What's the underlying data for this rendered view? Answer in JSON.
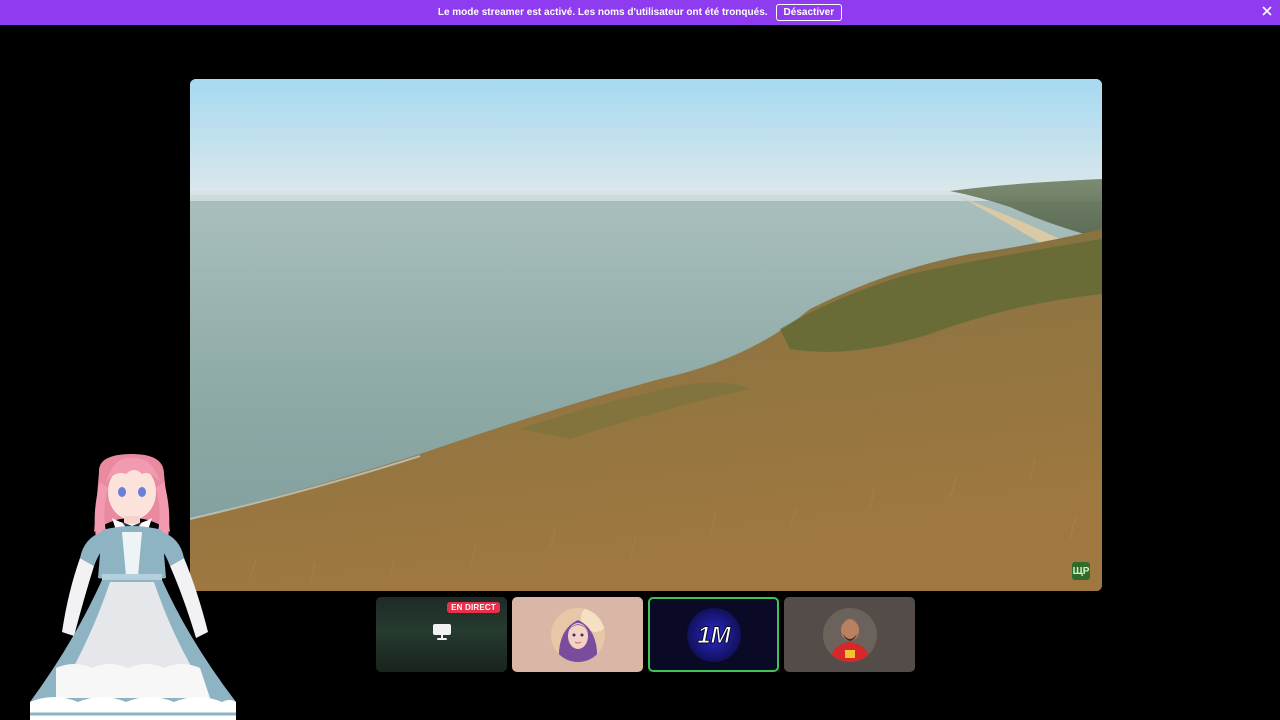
{
  "banner": {
    "message": "Le mode streamer est activé. Les noms d'utilisateur ont été tronqués.",
    "disable_label": "Désactiver",
    "background_color": "#8f3cf0"
  },
  "main_stream": {
    "scene": "coastal cliff with grassy slope and sea",
    "logo_text": "ЩР"
  },
  "tiles": [
    {
      "type": "screen-share",
      "live_label": "EN DIRECT",
      "icon": "monitor-icon"
    },
    {
      "type": "avatar",
      "icon": "purple-hair-girl-avatar"
    },
    {
      "type": "avatar",
      "avatar_text": "1M",
      "selected": true
    },
    {
      "type": "avatar",
      "icon": "football-player-avatar"
    }
  ],
  "colors": {
    "live_badge": "#e8304a",
    "selected_tile_border": "#3ec35a"
  }
}
